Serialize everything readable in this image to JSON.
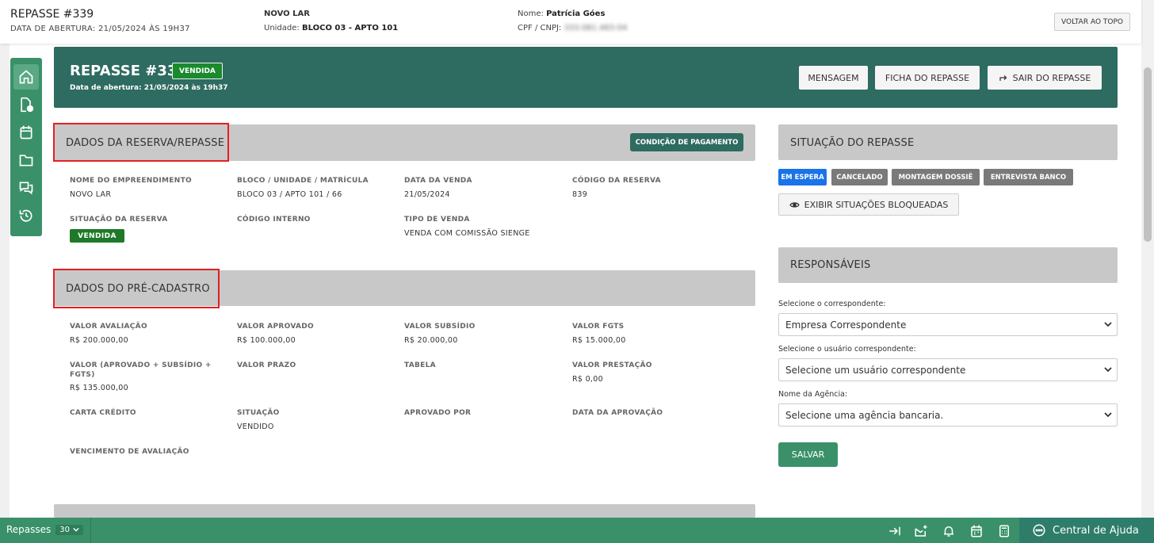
{
  "topbar": {
    "title": "REPASSE #339",
    "opening": "DATA DE ABERTURA: 21/05/2024 ÀS 19H37",
    "empreendimento": "NOVO LAR",
    "unit_label": "Unidade:",
    "unit_value": "BLOCO 03 - APTO 101",
    "name_label": "Nome:",
    "name_value": "Patrícia Góes",
    "cpf_label": "CPF / CNPJ:",
    "cpf_value": "333.081.483-04",
    "back_top": "VOLTAR AO TOPO"
  },
  "sidenav": {
    "items": [
      {
        "icon": "home-icon"
      },
      {
        "icon": "document-icon"
      },
      {
        "icon": "calendar-icon"
      },
      {
        "icon": "folder-icon"
      },
      {
        "icon": "chat-icon"
      },
      {
        "icon": "history-icon"
      }
    ]
  },
  "banner": {
    "title": "REPASSE #339",
    "badge": "VENDIDA",
    "date": "Data de abertura: 21/05/2024 às 19h37",
    "btn_message": "MENSAGEM",
    "btn_ficha": "FICHA DO REPASSE",
    "btn_exit": "SAIR DO REPASSE"
  },
  "reserva": {
    "title": "DADOS DA RESERVA/REPASSE",
    "payment_btn": "CONDIÇÃO DE PAGAMENTO",
    "fields": [
      {
        "label": "NOME DO EMPREENDIMENTO",
        "value": "NOVO LAR"
      },
      {
        "label": "BLOCO / UNIDADE / MATRÍCULA",
        "value": "BLOCO 03 / APTO 101 / 66"
      },
      {
        "label": "DATA DA VENDA",
        "value": "21/05/2024"
      },
      {
        "label": "CÓDIGO DA RESERVA",
        "value": "839"
      },
      {
        "label": "SITUAÇÃO DA RESERVA",
        "value": "VENDIDA"
      },
      {
        "label": "CÓDIGO INTERNO",
        "value": ""
      },
      {
        "label": "TIPO DE VENDA",
        "value": "VENDA COM COMISSÃO SIENGE"
      }
    ]
  },
  "precadastro": {
    "title": "DADOS DO PRÉ-CADASTRO",
    "fields": [
      {
        "label": "VALOR AVALIAÇÃO",
        "value": "R$ 200.000,00"
      },
      {
        "label": "VALOR APROVADO",
        "value": "R$ 100.000,00"
      },
      {
        "label": "VALOR SUBSÍDIO",
        "value": "R$ 20.000,00"
      },
      {
        "label": "VALOR FGTS",
        "value": "R$ 15.000,00"
      },
      {
        "label": "VALOR (APROVADO + SUBSÍDIO + FGTS)",
        "value": "R$ 135.000,00"
      },
      {
        "label": "VALOR PRAZO",
        "value": ""
      },
      {
        "label": "TABELA",
        "value": ""
      },
      {
        "label": "VALOR PRESTAÇÃO",
        "value": "R$ 0,00"
      },
      {
        "label": "CARTA CRÉDITO",
        "value": ""
      },
      {
        "label": "SITUAÇÃO",
        "value": "VENDIDO"
      },
      {
        "label": "APROVADO POR",
        "value": ""
      },
      {
        "label": "DATA DA APROVAÇÃO",
        "value": ""
      },
      {
        "label": "VENCIMENTO DE AVALIAÇÃO",
        "value": ""
      }
    ]
  },
  "situacao": {
    "title": "SITUAÇÃO DO REPASSE",
    "statuses": [
      {
        "label": "EM ESPERA",
        "color": "#1a73e8"
      },
      {
        "label": "CANCELADO",
        "color": "#7a7a7a"
      },
      {
        "label": "MONTAGEM DOSSIÊ",
        "color": "#7a7a7a"
      },
      {
        "label": "ENTREVISTA BANCO",
        "color": "#7a7a7a"
      }
    ],
    "show_blocked": "EXIBIR SITUAÇÕES BLOQUEADAS"
  },
  "responsaveis": {
    "title": "RESPONSÁVEIS",
    "corresp_label": "Selecione o correspondente:",
    "corresp_value": "Empresa Correspondente",
    "user_label": "Selecione o usuário correspondente:",
    "user_value": "Selecione um usuário correspondente",
    "agency_label": "Nome da Agência:",
    "agency_value": "Selecione uma agência bancaria.",
    "save": "SALVAR"
  },
  "bottombar": {
    "repasses_label": "Repasses",
    "repasses_count": "30",
    "help": "Central de Ajuda"
  },
  "colors": {
    "brand_green": "#3a9169",
    "banner_teal": "#2e6b61",
    "badge_green": "#1e7a28",
    "highlight_red": "#e51f1f"
  }
}
